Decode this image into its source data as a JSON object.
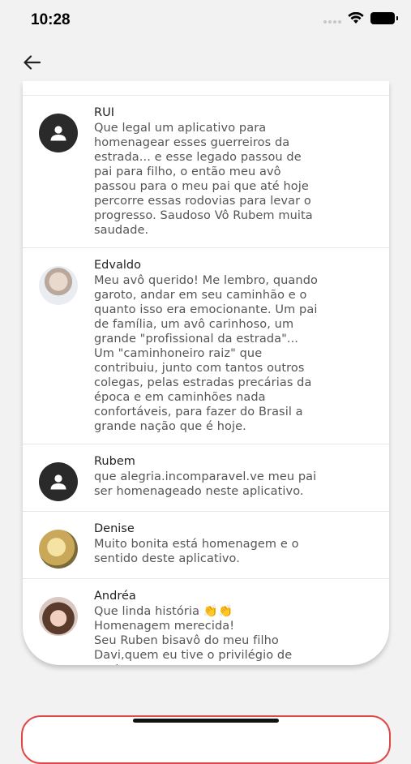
{
  "status_bar": {
    "time": "10:28"
  },
  "comments": [
    {
      "author": "RUI",
      "avatar": "user-icon",
      "text": "Que legal um aplicativo para\nhomenagear esses guerreiros da\nestrada... e esse legado passou de\npai para filho, o então meu avô\npassou para o meu pai que até hoje\npercorre essas rodovias para levar o\nprogresso. Saudoso Vô Rubem muita\nsaudade."
    },
    {
      "author": "Edvaldo",
      "avatar": "photo",
      "text": "Meu avô querido! Me lembro, quando\ngaroto, andar em seu caminhão e o\nquanto isso era emocionante. Um pai\nde família, um avô carinhoso, um\ngrande \"profissional da estrada\"...\nUm \"caminhoneiro raiz\" que\ncontribuiu, junto com tantos outros\ncolegas, pelas estradas precárias da\népoca e em caminhões nada\nconfortáveis, para fazer do Brasil a\ngrande nação que é hoje."
    },
    {
      "author": "Rubem",
      "avatar": "user-icon",
      "text": "que alegria.incomparavel.ve meu pai\nser homenageado neste aplicativo."
    },
    {
      "author": "Denise",
      "avatar": "photo",
      "text": "Muito bonita está homenagem e o\nsentido deste aplicativo."
    },
    {
      "author": "Andréa",
      "avatar": "photo",
      "text": "Que linda história 👏👏\nHomenagem merecida!\nSeu Ruben bisavô do meu filho\nDavi,quem eu tive o privilégio de\nconhecer..."
    }
  ]
}
